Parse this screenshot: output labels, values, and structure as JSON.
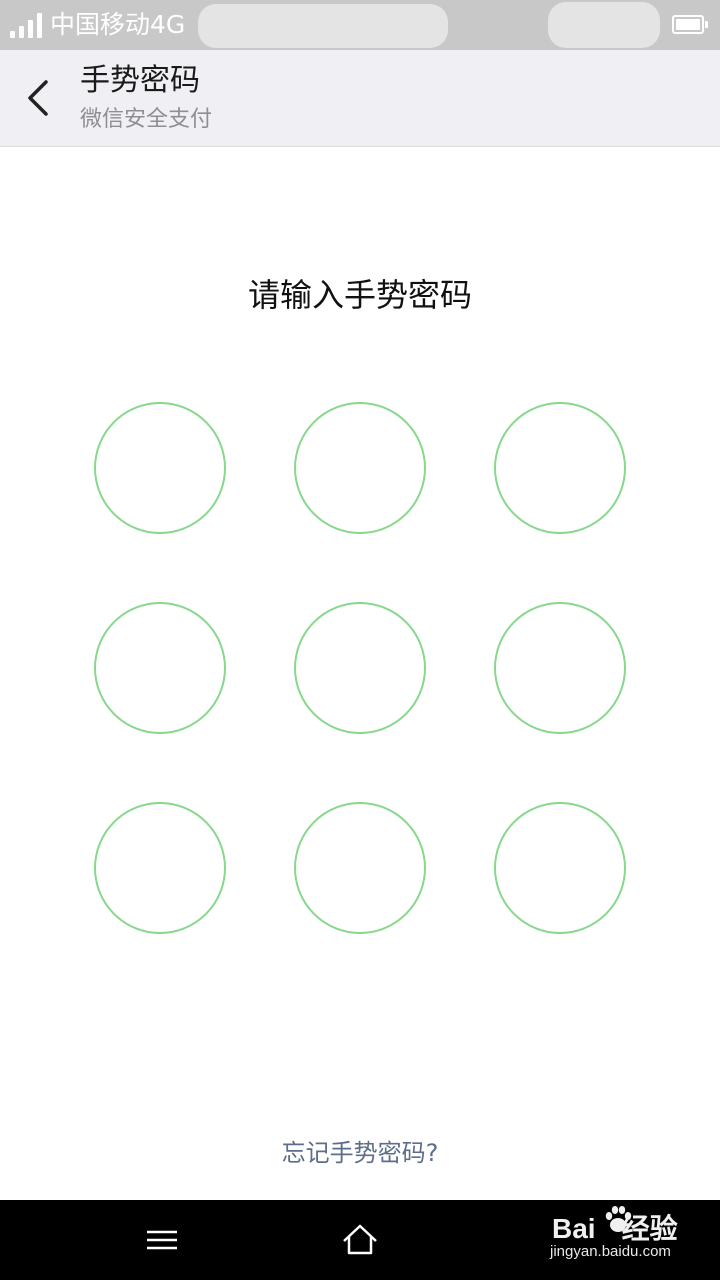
{
  "status_bar": {
    "carrier": "中国移动4G",
    "signal_icon": "signal-bars-icon",
    "battery_icon": "battery-icon",
    "battery_level": 1.0
  },
  "header": {
    "title": "手势密码",
    "subtitle": "微信安全支付",
    "back_icon": "chevron-left-icon"
  },
  "gesture": {
    "prompt": "请输入手势密码",
    "rows": 3,
    "cols": 3,
    "ring_color": "#88d88c"
  },
  "forgot_link": "忘记手势密码?",
  "nav_bar": {
    "menu_icon": "menu-icon",
    "home_icon": "home-icon"
  },
  "watermark": {
    "logo_text": "Bai",
    "logo_suffix": "经验",
    "url": "jingyan.baidu.com"
  }
}
